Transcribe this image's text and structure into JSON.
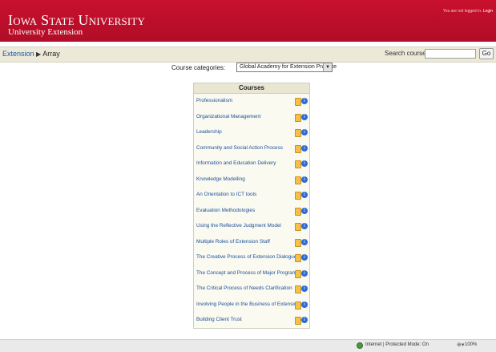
{
  "header": {
    "title": "Iowa State University",
    "subtitle": "University Extension",
    "login_prefix": "You are not logged in. ",
    "login_link": "Login"
  },
  "nav": {
    "breadcrumb": [
      "Extension",
      "Array"
    ],
    "separator": "▶",
    "search_label": "Search courses",
    "search_value": "",
    "go_label": "Go"
  },
  "categories": {
    "label": "Course categories:",
    "selected": "Global Academy for Extension Practice"
  },
  "courses": {
    "heading": "Courses",
    "items": [
      "Professionalism",
      "Organizational Management",
      "Leadership",
      "Community and Social Action Process",
      "Information and Education Delivery",
      "Knowledge Modelling",
      "An Orientation to ICT tools",
      "Evaluation Methodologies",
      "Using the Reflective Judgment Model",
      "Multiple Roles of Extension Staff",
      "The Creative Process of Extension Dialogue",
      "The Concept and Process of Major Programs",
      "The Critical Process of Needs Clarification",
      "Involving People in the Business of Extension",
      "Building Client Trust"
    ]
  },
  "status": {
    "zone": "Internet | Protected Mode: On",
    "zoom": "100%"
  }
}
